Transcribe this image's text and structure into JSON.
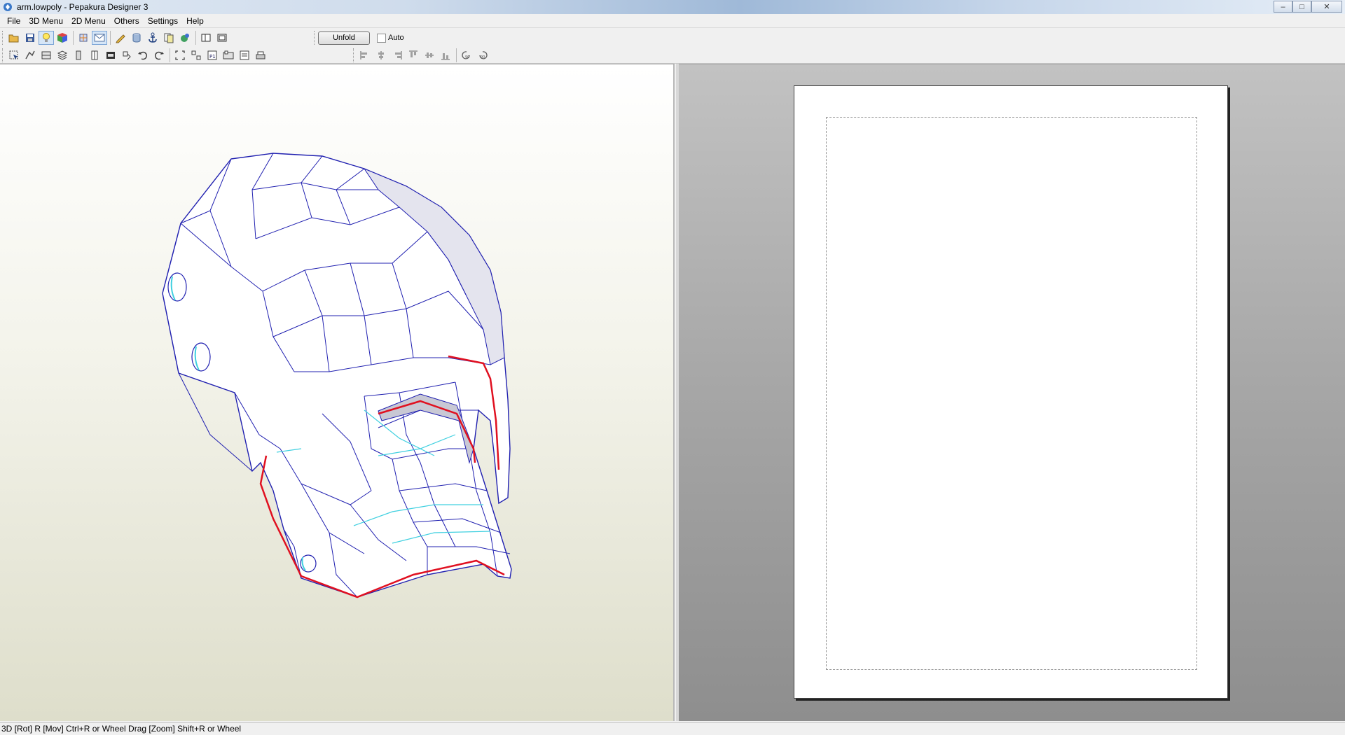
{
  "window": {
    "title": "arm.lowpoly - Pepakura Designer 3",
    "controls": [
      "minimize-icon",
      "maximize-icon",
      "close-icon"
    ]
  },
  "menubar": {
    "items": [
      {
        "label": "File"
      },
      {
        "label": "3D Menu"
      },
      {
        "label": "2D Menu"
      },
      {
        "label": "Others"
      },
      {
        "label": "Settings"
      },
      {
        "label": "Help"
      }
    ]
  },
  "toolbar": {
    "row1_icons": [
      "open-icon",
      "save-icon",
      "lightbulb-icon",
      "color-cube-icon",
      "texture-icon",
      "envelope-icon",
      "pencil-icon",
      "cylinder-icon",
      "anchor-icon",
      "pages-icon",
      "bulb-green-icon",
      "single-pane-icon",
      "split-pane-icon"
    ],
    "active_icons": [
      "lightbulb-icon",
      "envelope-icon"
    ],
    "unfold_label": "Unfold",
    "auto_label": "Auto",
    "auto_checked": false,
    "row2_icons": [
      "select-icon",
      "join-icon",
      "flap-icon",
      "layers-icon",
      "column-icon",
      "column2-icon",
      "photo-icon",
      "rotate-part-icon",
      "undo-icon",
      "redo-icon",
      "fit-icon",
      "fit-all-icon",
      "page-number-icon",
      "page-layout-icon",
      "print-preview-icon",
      "print-icon"
    ],
    "align_icons": [
      "align-left-icon",
      "align-center-icon",
      "align-right-icon",
      "align-top-icon",
      "align-middle-icon",
      "align-bottom-icon",
      "rotate-90-left-icon",
      "rotate-90-right-icon"
    ]
  },
  "statusbar": {
    "text": "3D [Rot] R [Mov] Ctrl+R or Wheel Drag [Zoom] Shift+R or Wheel"
  },
  "colors": {
    "edge_blue": "#2020b0",
    "cut_red": "#e01020",
    "fold_cyan": "#40d0e0"
  }
}
